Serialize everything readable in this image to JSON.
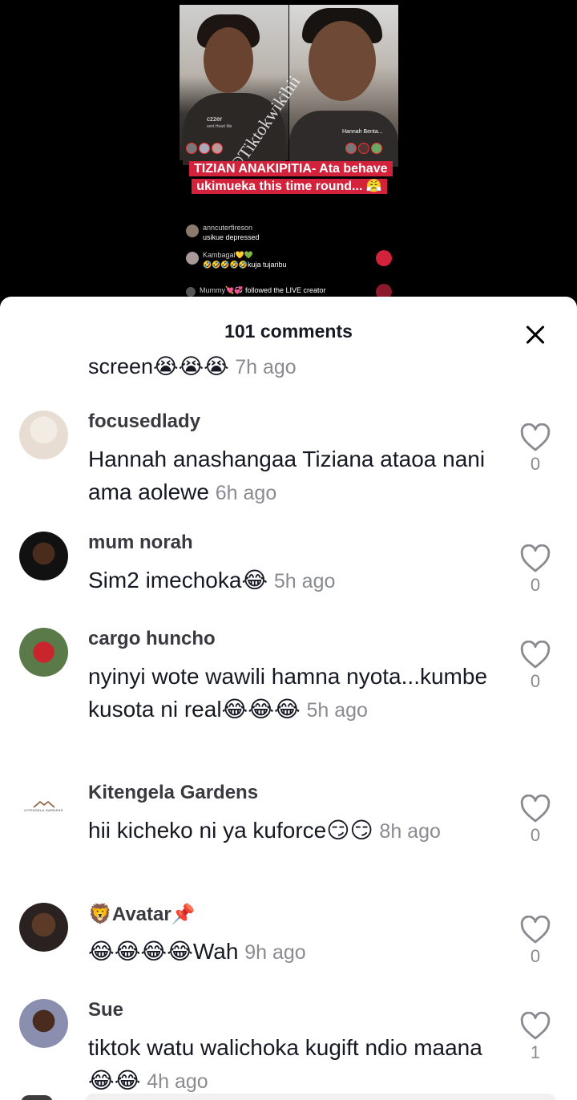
{
  "video": {
    "left_user": "czzer",
    "left_user_sub": "sent Heart Me",
    "right_user": "Hannah Benta...",
    "watermark": "@Tiktokwikihii",
    "caption": "TIZIAN ANAKIPITIA- Ata behave ukimueka this time round... 😤",
    "live_comments": [
      {
        "user": "anncuterfireson",
        "text": "usikue depressed"
      },
      {
        "user": "Kambagal💛💚",
        "text": "🤣🤣🤣🤣🤣kuja tujaribu"
      },
      {
        "user": "Mummy💘💞",
        "text": "followed the LIVE creator"
      }
    ]
  },
  "sheet": {
    "title": "101 comments",
    "partial_comment": {
      "text": "screen😭😭😭",
      "time": "7h ago"
    }
  },
  "comments": [
    {
      "user": "focusedlady",
      "text": "Hannah anashangaa Tiziana ataoa nani ama aolewe",
      "time": "6h ago",
      "likes": "0"
    },
    {
      "user": "mum norah",
      "text": "Sim2 imechoka😂",
      "time": "5h ago",
      "likes": "0"
    },
    {
      "user": "cargo huncho",
      "text": "nyinyi wote wawili hamna nyota...kumbe kusota ni real😂😂😂",
      "time": "5h ago",
      "likes": "0"
    },
    {
      "user": "Kitengela Gardens",
      "text": "hii kicheko ni ya kuforce😏😏",
      "time": "8h ago",
      "likes": "0",
      "avatar_text": "KITENGELA GARDENS"
    },
    {
      "user": "🦁Avatar📌",
      "text": "😂😂😂😂Wah",
      "time": "9h ago",
      "likes": "0"
    },
    {
      "user": "Sue",
      "text": "tiktok watu walichoka kugift ndio maana😂😂",
      "time": "4h ago",
      "likes": "1"
    }
  ],
  "colors": {
    "caption_bg": "#d3223b",
    "muted": "#8a8b91",
    "text": "#161823"
  }
}
